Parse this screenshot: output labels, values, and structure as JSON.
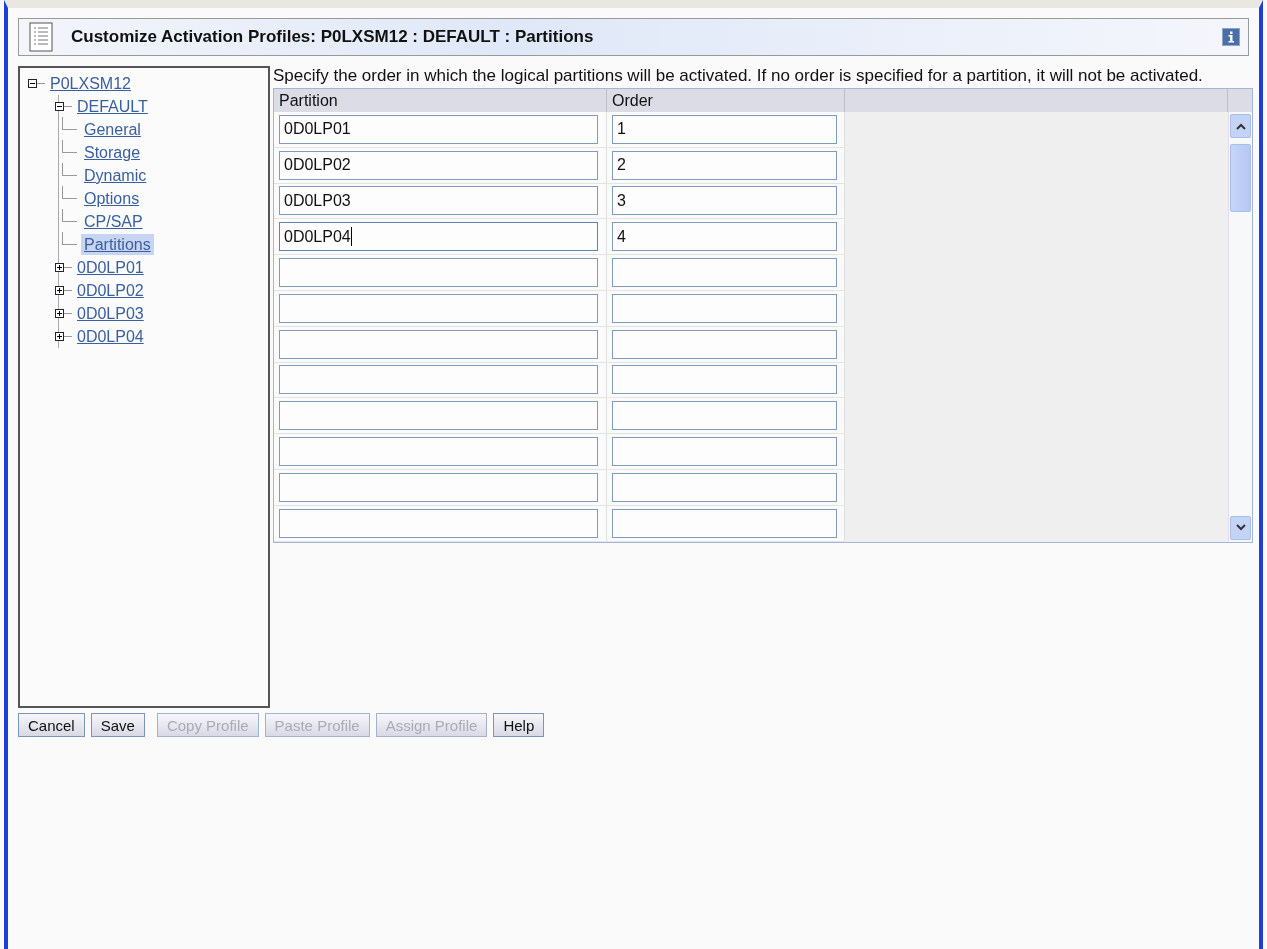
{
  "window": {
    "title": "Customize Activation Profiles: P0LXSM12 : DEFAULT : Partitions"
  },
  "tree": [
    {
      "label": "P0LXSM12",
      "expanded": true,
      "selected": false,
      "children": [
        {
          "label": "DEFAULT",
          "expanded": true,
          "selected": false,
          "children": [
            {
              "label": "General",
              "selected": false
            },
            {
              "label": "Storage",
              "selected": false
            },
            {
              "label": "Dynamic",
              "selected": false
            },
            {
              "label": "Options",
              "selected": false
            },
            {
              "label": "CP/SAP",
              "selected": false
            },
            {
              "label": "Partitions",
              "selected": true
            }
          ]
        },
        {
          "label": "0D0LP01",
          "expanded": false,
          "selected": false
        },
        {
          "label": "0D0LP02",
          "expanded": false,
          "selected": false
        },
        {
          "label": "0D0LP03",
          "expanded": false,
          "selected": false
        },
        {
          "label": "0D0LP04",
          "expanded": false,
          "selected": false
        }
      ]
    }
  ],
  "instructions": "Specify the order in which the logical partitions will be activated. If no order is specified for a partition, it will not be activated.",
  "table": {
    "columns": [
      "Partition",
      "Order"
    ],
    "rows": [
      {
        "partition": "0D0LP01",
        "order": "1",
        "focused": false
      },
      {
        "partition": "0D0LP02",
        "order": "2",
        "focused": false
      },
      {
        "partition": "0D0LP03",
        "order": "3",
        "focused": false
      },
      {
        "partition": "0D0LP04",
        "order": "4",
        "focused": true
      },
      {
        "focused": false
      },
      {
        "focused": false
      },
      {
        "focused": false
      },
      {
        "focused": false
      },
      {
        "focused": false
      },
      {
        "focused": false
      },
      {
        "focused": false
      },
      {
        "focused": false
      }
    ]
  },
  "buttons": [
    {
      "label": "Cancel",
      "disabled": false
    },
    {
      "label": "Save",
      "disabled": false
    },
    {
      "label": "Copy Profile",
      "disabled": true
    },
    {
      "label": "Paste Profile",
      "disabled": true
    },
    {
      "label": "Assign Profile",
      "disabled": true
    },
    {
      "label": "Help",
      "disabled": false
    }
  ]
}
